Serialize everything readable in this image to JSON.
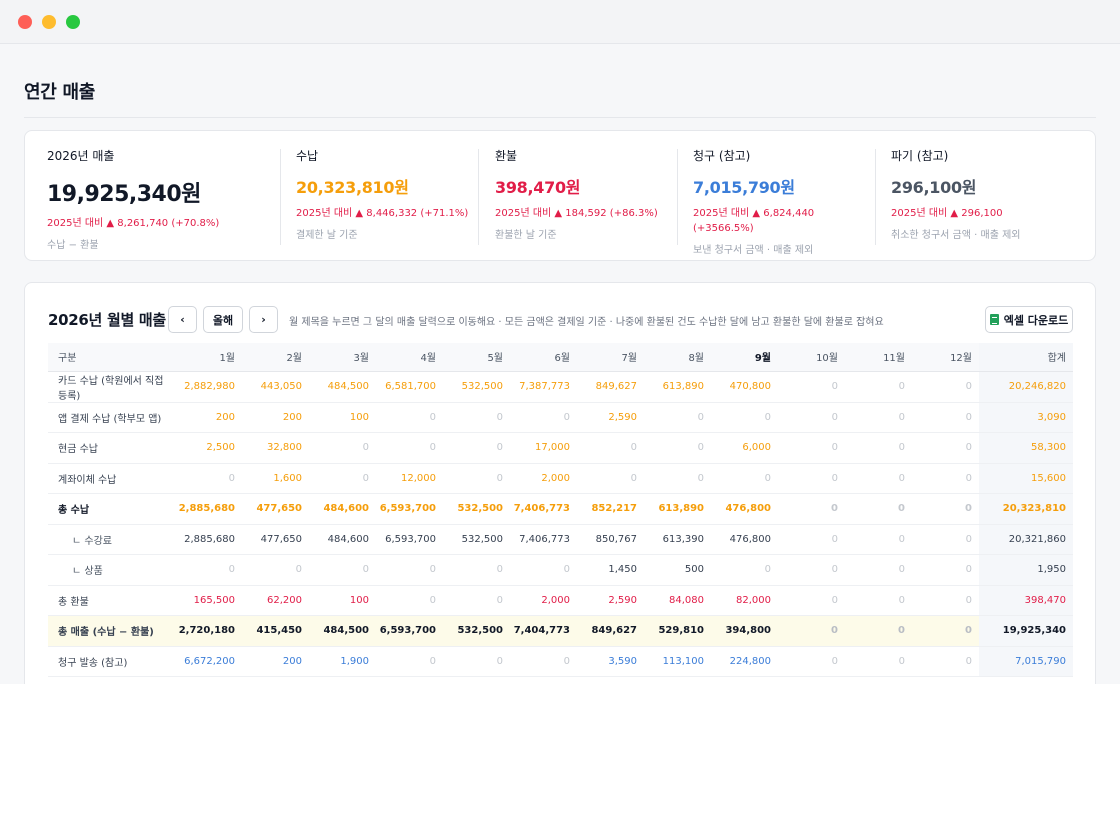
{
  "page": {
    "title": "연간 매출"
  },
  "summary": [
    {
      "label": "2026년 매출",
      "value": "19,925,340원",
      "delta": "2025년 대비 ▲ 8,261,740 (+70.8%)",
      "note": "수납 − 환불"
    },
    {
      "label": "수납",
      "value": "20,323,810원",
      "delta": "2025년 대비 ▲ 8,446,332 (+71.1%)",
      "note": "결제한 날 기준"
    },
    {
      "label": "환불",
      "value": "398,470원",
      "delta": "2025년 대비 ▲ 184,592 (+86.3%)",
      "note": "환불한 날 기준"
    },
    {
      "label": "청구 (참고)",
      "value": "7,015,790원",
      "delta": "2025년 대비 ▲ 6,824,440 (+3566.5%)",
      "note": "보낸 청구서 금액 · 매출 제외"
    },
    {
      "label": "파기 (참고)",
      "value": "296,100원",
      "delta": "2025년 대비 ▲ 296,100",
      "note": "취소한 청구서 금액 · 매출 제외"
    }
  ],
  "monthly": {
    "title": "2026년 월별 매출",
    "prev_label": "‹",
    "this_year_label": "올해",
    "next_label": "›",
    "hint": "월 제목을 누르면 그 달의 매출 달력으로 이동해요 · 모든 금액은 결제일 기준 · 나중에 환불된 건도 수납한 달에 남고 환불한 달에 환불로 잡혀요",
    "excel_label": "엑셀 다운로드",
    "columns": [
      "구분",
      "1월",
      "2월",
      "3월",
      "4월",
      "5월",
      "6월",
      "7월",
      "8월",
      "9월",
      "10월",
      "11월",
      "12월",
      "합계"
    ],
    "rows": [
      {
        "label": "카드 수납 (학원에서 직접 등록)",
        "cells": [
          "2,882,980",
          "443,050",
          "484,500",
          "6,581,700",
          "532,500",
          "7,387,773",
          "849,627",
          "613,890",
          "470,800",
          "0",
          "0",
          "0",
          "20,246,820"
        ]
      },
      {
        "label": "앱 결제 수납 (학부모 앱)",
        "cells": [
          "200",
          "200",
          "100",
          "0",
          "0",
          "0",
          "2,590",
          "0",
          "0",
          "0",
          "0",
          "0",
          "3,090"
        ]
      },
      {
        "label": "현금 수납",
        "cells": [
          "2,500",
          "32,800",
          "0",
          "0",
          "0",
          "17,000",
          "0",
          "0",
          "6,000",
          "0",
          "0",
          "0",
          "58,300"
        ]
      },
      {
        "label": "계좌이체 수납",
        "cells": [
          "0",
          "1,600",
          "0",
          "12,000",
          "0",
          "2,000",
          "0",
          "0",
          "0",
          "0",
          "0",
          "0",
          "15,600"
        ]
      },
      {
        "label": "총 수납",
        "cells": [
          "2,885,680",
          "477,650",
          "484,600",
          "6,593,700",
          "532,500",
          "7,406,773",
          "852,217",
          "613,890",
          "476,800",
          "0",
          "0",
          "0",
          "20,323,810"
        ]
      },
      {
        "label": "ㄴ 수강료",
        "cells": [
          "2,885,680",
          "477,650",
          "484,600",
          "6,593,700",
          "532,500",
          "7,406,773",
          "850,767",
          "613,390",
          "476,800",
          "0",
          "0",
          "0",
          "20,321,860"
        ]
      },
      {
        "label": "ㄴ 상품",
        "cells": [
          "0",
          "0",
          "0",
          "0",
          "0",
          "0",
          "1,450",
          "500",
          "0",
          "0",
          "0",
          "0",
          "1,950"
        ]
      },
      {
        "label": "총 환불",
        "cells": [
          "165,500",
          "62,200",
          "100",
          "0",
          "0",
          "2,000",
          "2,590",
          "84,080",
          "82,000",
          "0",
          "0",
          "0",
          "398,470"
        ]
      },
      {
        "label": "총 매출 (수납 − 환불)",
        "cells": [
          "2,720,180",
          "415,450",
          "484,500",
          "6,593,700",
          "532,500",
          "7,404,773",
          "849,627",
          "529,810",
          "394,800",
          "0",
          "0",
          "0",
          "19,925,340"
        ]
      },
      {
        "label": "청구 발송 (참고)",
        "cells": [
          "6,672,200",
          "200",
          "1,900",
          "0",
          "0",
          "0",
          "3,590",
          "113,100",
          "224,800",
          "0",
          "0",
          "0",
          "7,015,790"
        ]
      }
    ]
  },
  "colors": {
    "orange": "#f59e0b",
    "red": "#e11d48",
    "blue": "#3b7dd8"
  }
}
